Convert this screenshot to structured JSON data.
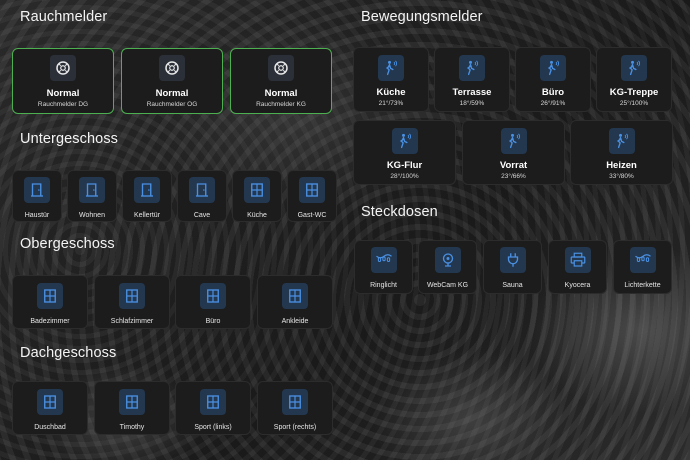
{
  "sections": {
    "rauchmelder": "Rauchmelder",
    "bewegungsmelder": "Bewegungsmelder",
    "untergeschoss": "Untergeschoss",
    "obergeschoss": "Obergeschoss",
    "dachgeschoss": "Dachgeschoss",
    "steckdosen": "Steckdosen"
  },
  "rauchmelder": [
    {
      "state": "Normal",
      "name": "Rauchmelder DG"
    },
    {
      "state": "Normal",
      "name": "Rauchmelder OG"
    },
    {
      "state": "Normal",
      "name": "Rauchmelder KG"
    }
  ],
  "bewegungsmelder": [
    {
      "name": "Küche",
      "reading": "21°/73%"
    },
    {
      "name": "Terrasse",
      "reading": "18°/59%"
    },
    {
      "name": "Büro",
      "reading": "26°/91%"
    },
    {
      "name": "KG-Treppe",
      "reading": "25°/100%"
    },
    {
      "name": "KG-Flur",
      "reading": "28°/100%"
    },
    {
      "name": "Vorrat",
      "reading": "23°/66%"
    },
    {
      "name": "Heizen",
      "reading": "33°/80%"
    }
  ],
  "untergeschoss": [
    {
      "name": "Haustür",
      "icon": "door-icon"
    },
    {
      "name": "Wohnen",
      "icon": "door-icon"
    },
    {
      "name": "Kellertür",
      "icon": "door-icon"
    },
    {
      "name": "Cave",
      "icon": "door-icon"
    },
    {
      "name": "Küche",
      "icon": "window-icon"
    },
    {
      "name": "Gast-WC",
      "icon": "window-icon"
    }
  ],
  "obergeschoss": [
    {
      "name": "Badezimmer",
      "icon": "window-icon"
    },
    {
      "name": "Schlafzimmer",
      "icon": "window-icon"
    },
    {
      "name": "Büro",
      "icon": "window-icon"
    },
    {
      "name": "Ankleide",
      "icon": "window-icon"
    }
  ],
  "dachgeschoss": [
    {
      "name": "Duschbad",
      "icon": "window-icon"
    },
    {
      "name": "Timothy",
      "icon": "window-icon"
    },
    {
      "name": "Sport (links)",
      "icon": "window-icon"
    },
    {
      "name": "Sport (rechts)",
      "icon": "window-icon"
    }
  ],
  "steckdosen": [
    {
      "name": "Ringlicht",
      "icon": "string-lights-icon"
    },
    {
      "name": "WebCam KG",
      "icon": "webcam-icon"
    },
    {
      "name": "Sauna",
      "icon": "power-plug-icon"
    },
    {
      "name": "Kyocera",
      "icon": "printer-icon"
    },
    {
      "name": "Lichterkette",
      "icon": "string-lights-icon"
    }
  ],
  "colors": {
    "smoke_border": "#4caf50",
    "icon_blue": "#4a90e2",
    "icon_white": "#e8e8e8"
  }
}
